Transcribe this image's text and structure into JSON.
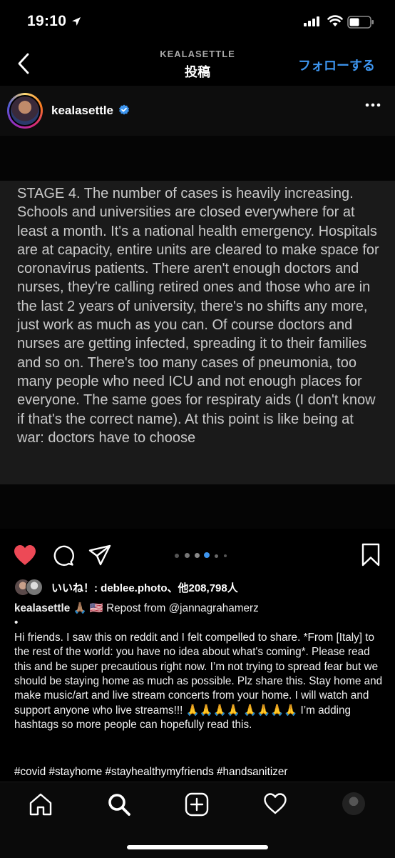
{
  "status_bar": {
    "time": "19:10"
  },
  "nav": {
    "subtitle": "KEALASETTLE",
    "title": "投稿",
    "follow_label": "フォローする"
  },
  "post": {
    "username": "kealasettle",
    "verified": true,
    "media_text": "STAGE 4. The number of cases is heavily increasing. Schools and universities are closed everywhere for at least a month. It's a national health emergency. Hospitals are at capacity, entire units are cleared to make space for coronavirus patients. There aren't enough doctors and nurses, they're calling retired ones and those who are in the last 2 years of university, there's no shifts any more, just work as much as you can. Of course doctors and nurses are getting infected, spreading it to their families and so on. There's too many cases of pneumonia, too many people who need ICU and not enough places for everyone. The same goes for respiraty aids (I don't know if that's the correct name). At this point is like being at war: doctors have to choose",
    "carousel": {
      "count": 6,
      "active_index": 3
    },
    "liked": true,
    "likes_text": "いいね！: deblee.photo、他208,798人",
    "caption_user": "kealasettle",
    "caption_first_line": " 🙏🏽 🇺🇸 Repost from @jannagrahamerz",
    "caption_body": "•\nHi friends. I saw this on reddit and I felt compelled to share. *From [Italy] to the rest of the world: you have no idea about what's coming*. Please read this and be super precautious right now. I’m not trying to spread fear but we should be staying home as much as possible. Plz share this. Stay home and make music/art and live stream concerts from your home. I will watch and support anyone who live streams!!! 🙏🙏🙏🙏 🙏🙏🙏🙏 I’m adding hashtags so more people can hopefully read this.",
    "hashtags": "#covid #stayhome #stayhealthymyfriends #handsanitizer"
  },
  "colors": {
    "accent": "#3d95ef",
    "like_red": "#ed4956",
    "carousel_active": "#3d95ef"
  },
  "icons": {
    "status": [
      "location-arrow-icon",
      "signal-icon",
      "wifi-icon",
      "battery-icon"
    ],
    "actions": [
      "heart-icon",
      "comment-icon",
      "share-icon",
      "bookmark-icon"
    ],
    "tabs": [
      "home-icon",
      "search-icon",
      "add-post-icon",
      "activity-heart-icon",
      "profile-avatar-icon"
    ]
  }
}
